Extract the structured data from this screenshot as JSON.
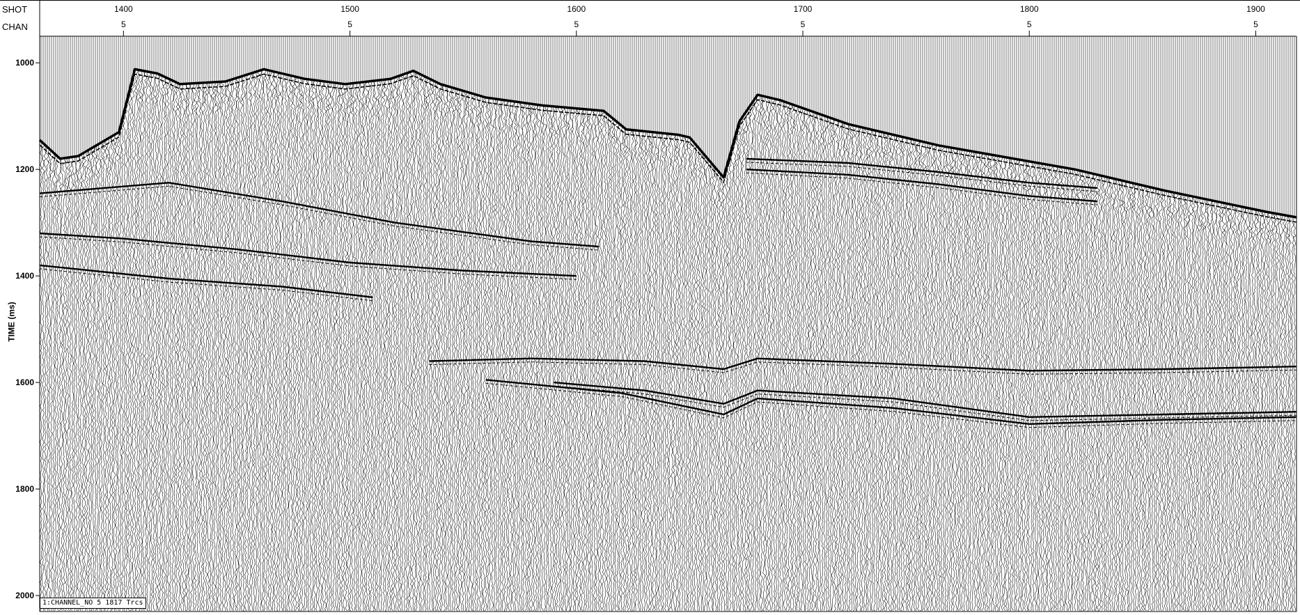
{
  "header": {
    "shot_label": "SHOT",
    "chan_label": "CHAN"
  },
  "footer_text": "1:CHANNEL_NO 5 1817 Trcs",
  "colors": {
    "ink": "#000000",
    "paper": "#ffffff"
  },
  "chart_data": {
    "type": "seismic-wiggle-section",
    "ylabel": "TIME (ms)",
    "ylim": [
      950,
      2030
    ],
    "y_ticks": [
      1000,
      1200,
      1400,
      1600,
      1800,
      2000
    ],
    "x_axis": {
      "name": "SHOT",
      "range": [
        1363,
        1918
      ]
    },
    "shot_ticks": [
      1400,
      1500,
      1600,
      1700,
      1800,
      1900
    ],
    "chan_ticks": [
      {
        "shot": 1400,
        "label": "5"
      },
      {
        "shot": 1500,
        "label": "5"
      },
      {
        "shot": 1600,
        "label": "5"
      },
      {
        "shot": 1700,
        "label": "5"
      },
      {
        "shot": 1800,
        "label": "5"
      },
      {
        "shot": 1900,
        "label": "5"
      }
    ],
    "trace_count": 1817,
    "seafloor_horizon": [
      [
        1363,
        1145
      ],
      [
        1372,
        1180
      ],
      [
        1380,
        1175
      ],
      [
        1398,
        1130
      ],
      [
        1405,
        1012
      ],
      [
        1415,
        1020
      ],
      [
        1425,
        1040
      ],
      [
        1445,
        1035
      ],
      [
        1462,
        1012
      ],
      [
        1480,
        1030
      ],
      [
        1498,
        1040
      ],
      [
        1518,
        1030
      ],
      [
        1528,
        1015
      ],
      [
        1540,
        1040
      ],
      [
        1560,
        1065
      ],
      [
        1585,
        1080
      ],
      [
        1612,
        1090
      ],
      [
        1622,
        1125
      ],
      [
        1645,
        1135
      ],
      [
        1650,
        1140
      ],
      [
        1665,
        1215
      ],
      [
        1672,
        1110
      ],
      [
        1680,
        1060
      ],
      [
        1690,
        1070
      ],
      [
        1720,
        1115
      ],
      [
        1760,
        1155
      ],
      [
        1820,
        1200
      ],
      [
        1860,
        1240
      ],
      [
        1905,
        1280
      ],
      [
        1918,
        1290
      ]
    ],
    "reflectors": [
      {
        "points": [
          [
            1363,
            1245
          ],
          [
            1420,
            1225
          ],
          [
            1470,
            1260
          ],
          [
            1520,
            1300
          ],
          [
            1580,
            1335
          ],
          [
            1610,
            1345
          ]
        ]
      },
      {
        "points": [
          [
            1363,
            1320
          ],
          [
            1400,
            1330
          ],
          [
            1450,
            1350
          ],
          [
            1500,
            1375
          ],
          [
            1550,
            1390
          ],
          [
            1600,
            1400
          ]
        ]
      },
      {
        "points": [
          [
            1363,
            1380
          ],
          [
            1420,
            1405
          ],
          [
            1470,
            1420
          ],
          [
            1510,
            1440
          ]
        ]
      },
      {
        "points": [
          [
            1675,
            1200
          ],
          [
            1720,
            1210
          ],
          [
            1760,
            1228
          ],
          [
            1800,
            1250
          ],
          [
            1830,
            1260
          ]
        ]
      },
      {
        "points": [
          [
            1675,
            1180
          ],
          [
            1720,
            1188
          ],
          [
            1760,
            1205
          ],
          [
            1800,
            1225
          ],
          [
            1830,
            1235
          ]
        ]
      },
      {
        "points": [
          [
            1535,
            1560
          ],
          [
            1580,
            1555
          ],
          [
            1630,
            1560
          ],
          [
            1665,
            1575
          ],
          [
            1680,
            1555
          ],
          [
            1740,
            1565
          ],
          [
            1800,
            1578
          ],
          [
            1860,
            1575
          ],
          [
            1918,
            1570
          ]
        ]
      },
      {
        "points": [
          [
            1590,
            1600
          ],
          [
            1630,
            1615
          ],
          [
            1665,
            1640
          ],
          [
            1680,
            1615
          ],
          [
            1740,
            1630
          ],
          [
            1800,
            1665
          ],
          [
            1860,
            1660
          ],
          [
            1918,
            1655
          ]
        ]
      },
      {
        "points": [
          [
            1560,
            1595
          ],
          [
            1620,
            1620
          ],
          [
            1665,
            1660
          ],
          [
            1680,
            1630
          ],
          [
            1740,
            1648
          ],
          [
            1800,
            1678
          ],
          [
            1860,
            1670
          ],
          [
            1918,
            1665
          ]
        ]
      }
    ]
  }
}
